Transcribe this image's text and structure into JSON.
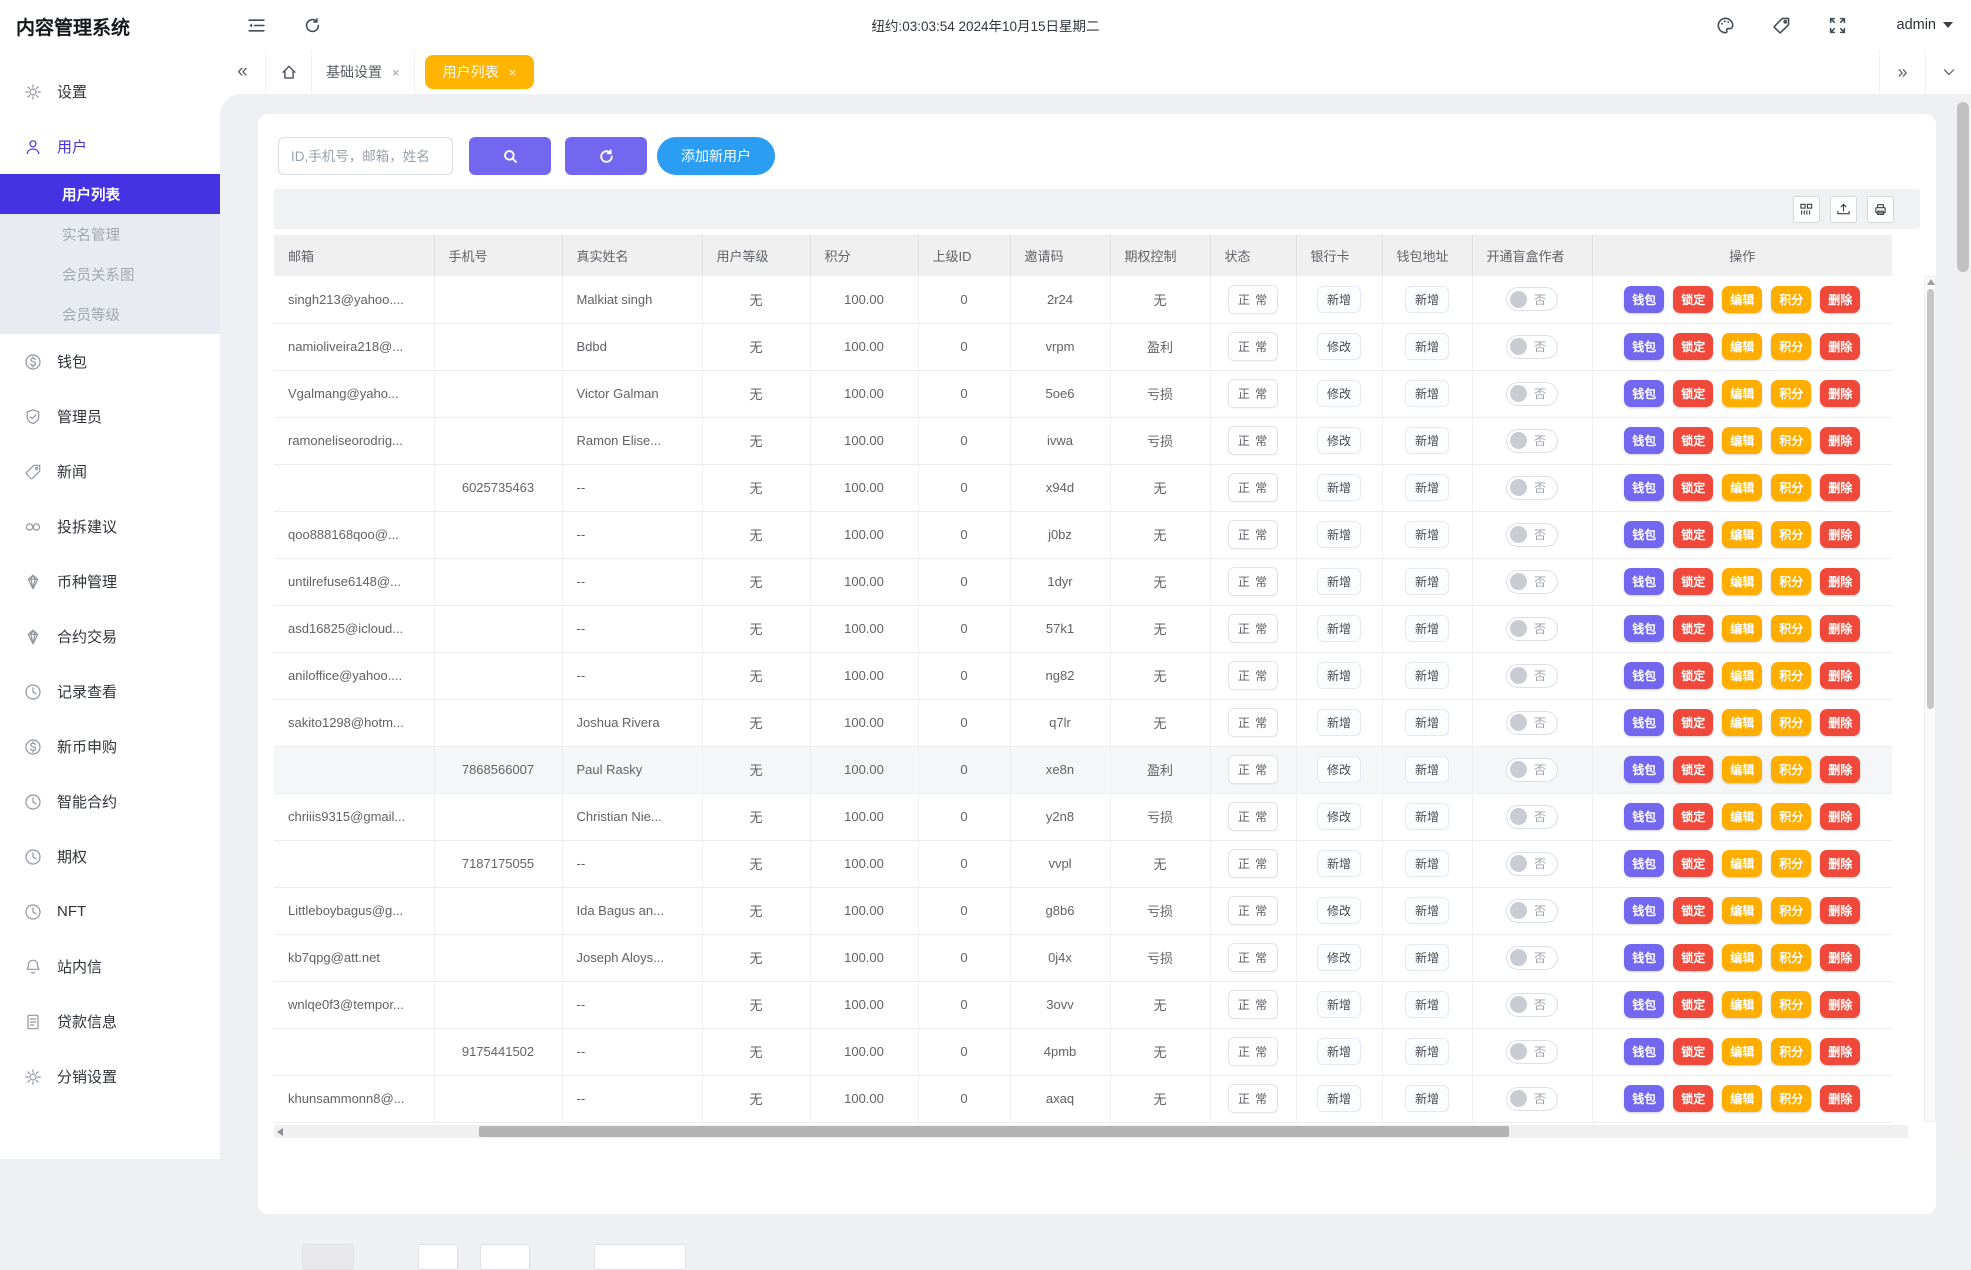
{
  "app": {
    "title": "内容管理系统",
    "clock": "纽约:03:03:54 2024年10月15日星期二",
    "user_menu": "admin"
  },
  "sidebar": {
    "items": [
      {
        "key": "settings",
        "icon": "gear",
        "label": "设置"
      },
      {
        "key": "users",
        "icon": "user",
        "label": "用户",
        "active": true,
        "children": [
          {
            "key": "user-list",
            "label": "用户列表",
            "active": true
          },
          {
            "key": "real-name",
            "label": "实名管理"
          },
          {
            "key": "member-graph",
            "label": "会员关系图"
          },
          {
            "key": "member-level",
            "label": "会员等级"
          }
        ]
      },
      {
        "key": "wallet",
        "icon": "dollar",
        "label": "钱包"
      },
      {
        "key": "admin",
        "icon": "shield",
        "label": "管理员"
      },
      {
        "key": "news",
        "icon": "tag",
        "label": "新闻"
      },
      {
        "key": "feedback",
        "icon": "link",
        "label": "投拆建议"
      },
      {
        "key": "currency-mgmt",
        "icon": "gem",
        "label": "币种管理"
      },
      {
        "key": "contract-trade",
        "icon": "gem",
        "label": "合约交易"
      },
      {
        "key": "record-view",
        "icon": "clock",
        "label": "记录查看"
      },
      {
        "key": "new-coin",
        "icon": "dollar",
        "label": "新币申购"
      },
      {
        "key": "smart-contract",
        "icon": "clock",
        "label": "智能合约"
      },
      {
        "key": "options",
        "icon": "clock",
        "label": "期权"
      },
      {
        "key": "nft",
        "icon": "clock",
        "label": "NFT"
      },
      {
        "key": "site-message",
        "icon": "bell",
        "label": "站内信"
      },
      {
        "key": "loan-info",
        "icon": "doc",
        "label": "贷款信息"
      },
      {
        "key": "distribution",
        "icon": "gear",
        "label": "分销设置"
      }
    ]
  },
  "tabs": {
    "items": [
      {
        "key": "basic-settings",
        "label": "基础设置",
        "active": false
      },
      {
        "key": "user-list",
        "label": "用户列表",
        "active": true
      }
    ]
  },
  "search": {
    "placeholder": "ID,手机号，邮箱，姓名",
    "add_button": "添加新用户"
  },
  "table": {
    "headers": [
      "邮箱",
      "手机号",
      "真实姓名",
      "用户等级",
      "积分",
      "上级ID",
      "邀请码",
      "期权控制",
      "状态",
      "银行卡",
      "钱包地址",
      "开通盲盒作者",
      "操作"
    ],
    "action_labels": [
      "钱包",
      "锁定",
      "编辑",
      "积分",
      "删除"
    ],
    "toggle_off_label": "否",
    "rows": [
      {
        "email": "singh213@yahoo....",
        "phone": "",
        "name": "Malkiat singh",
        "level": "无",
        "points": "100.00",
        "parent": "0",
        "invite": "2r24",
        "option": "无",
        "status": "正 常",
        "bank": "新增",
        "wallet": "新增",
        "blindbox": "否",
        "hover": false
      },
      {
        "email": "namioliveira218@...",
        "phone": "",
        "name": "Bdbd",
        "level": "无",
        "points": "100.00",
        "parent": "0",
        "invite": "vrpm",
        "option": "盈利",
        "status": "正 常",
        "bank": "修改",
        "wallet": "新增",
        "blindbox": "否",
        "hover": false
      },
      {
        "email": "Vgalmang@yaho...",
        "phone": "",
        "name": "Victor Galman",
        "level": "无",
        "points": "100.00",
        "parent": "0",
        "invite": "5oe6",
        "option": "亏损",
        "status": "正 常",
        "bank": "修改",
        "wallet": "新增",
        "blindbox": "否",
        "hover": false
      },
      {
        "email": "ramoneliseorodrig...",
        "phone": "",
        "name": "Ramon Elise...",
        "level": "无",
        "points": "100.00",
        "parent": "0",
        "invite": "ivwa",
        "option": "亏损",
        "status": "正 常",
        "bank": "修改",
        "wallet": "新增",
        "blindbox": "否",
        "hover": false
      },
      {
        "email": "",
        "phone": "6025735463",
        "name": "--",
        "level": "无",
        "points": "100.00",
        "parent": "0",
        "invite": "x94d",
        "option": "无",
        "status": "正 常",
        "bank": "新增",
        "wallet": "新增",
        "blindbox": "否",
        "hover": false
      },
      {
        "email": "qoo888168qoo@...",
        "phone": "",
        "name": "--",
        "level": "无",
        "points": "100.00",
        "parent": "0",
        "invite": "j0bz",
        "option": "无",
        "status": "正 常",
        "bank": "新增",
        "wallet": "新增",
        "blindbox": "否",
        "hover": false
      },
      {
        "email": "untilrefuse6148@...",
        "phone": "",
        "name": "--",
        "level": "无",
        "points": "100.00",
        "parent": "0",
        "invite": "1dyr",
        "option": "无",
        "status": "正 常",
        "bank": "新增",
        "wallet": "新增",
        "blindbox": "否",
        "hover": false
      },
      {
        "email": "asd16825@icloud...",
        "phone": "",
        "name": "--",
        "level": "无",
        "points": "100.00",
        "parent": "0",
        "invite": "57k1",
        "option": "无",
        "status": "正 常",
        "bank": "新增",
        "wallet": "新增",
        "blindbox": "否",
        "hover": false
      },
      {
        "email": "aniloffice@yahoo....",
        "phone": "",
        "name": "--",
        "level": "无",
        "points": "100.00",
        "parent": "0",
        "invite": "ng82",
        "option": "无",
        "status": "正 常",
        "bank": "新增",
        "wallet": "新增",
        "blindbox": "否",
        "hover": false
      },
      {
        "email": "sakito1298@hotm...",
        "phone": "",
        "name": "Joshua Rivera",
        "level": "无",
        "points": "100.00",
        "parent": "0",
        "invite": "q7lr",
        "option": "无",
        "status": "正 常",
        "bank": "新增",
        "wallet": "新增",
        "blindbox": "否",
        "hover": false
      },
      {
        "email": "",
        "phone": "7868566007",
        "name": "Paul Rasky",
        "level": "无",
        "points": "100.00",
        "parent": "0",
        "invite": "xe8n",
        "option": "盈利",
        "status": "正 常",
        "bank": "修改",
        "wallet": "新增",
        "blindbox": "否",
        "hover": true
      },
      {
        "email": "chriiis9315@gmail...",
        "phone": "",
        "name": "Christian Nie...",
        "level": "无",
        "points": "100.00",
        "parent": "0",
        "invite": "y2n8",
        "option": "亏损",
        "status": "正 常",
        "bank": "修改",
        "wallet": "新增",
        "blindbox": "否",
        "hover": false
      },
      {
        "email": "",
        "phone": "7187175055",
        "name": "--",
        "level": "无",
        "points": "100.00",
        "parent": "0",
        "invite": "vvpl",
        "option": "无",
        "status": "正 常",
        "bank": "新增",
        "wallet": "新增",
        "blindbox": "否",
        "hover": false
      },
      {
        "email": "Littleboybagus@g...",
        "phone": "",
        "name": "Ida Bagus an...",
        "level": "无",
        "points": "100.00",
        "parent": "0",
        "invite": "g8b6",
        "option": "亏损",
        "status": "正 常",
        "bank": "修改",
        "wallet": "新增",
        "blindbox": "否",
        "hover": false
      },
      {
        "email": "kb7qpg@att.net",
        "phone": "",
        "name": "Joseph Aloys...",
        "level": "无",
        "points": "100.00",
        "parent": "0",
        "invite": "0j4x",
        "option": "亏损",
        "status": "正 常",
        "bank": "修改",
        "wallet": "新增",
        "blindbox": "否",
        "hover": false
      },
      {
        "email": "wnlqe0f3@tempor...",
        "phone": "",
        "name": "--",
        "level": "无",
        "points": "100.00",
        "parent": "0",
        "invite": "3ovv",
        "option": "无",
        "status": "正 常",
        "bank": "新增",
        "wallet": "新增",
        "blindbox": "否",
        "hover": false
      },
      {
        "email": "",
        "phone": "9175441502",
        "name": "--",
        "level": "无",
        "points": "100.00",
        "parent": "0",
        "invite": "4pmb",
        "option": "无",
        "status": "正 常",
        "bank": "新增",
        "wallet": "新增",
        "blindbox": "否",
        "hover": false
      },
      {
        "email": "khunsammonn8@...",
        "phone": "",
        "name": "--",
        "level": "无",
        "points": "100.00",
        "parent": "0",
        "invite": "axaq",
        "option": "无",
        "status": "正 常",
        "bank": "新增",
        "wallet": "新增",
        "blindbox": "否",
        "hover": false
      }
    ]
  },
  "colors": {
    "accent_purple": "#4432e3",
    "button_purple": "#7367f0",
    "button_blue": "#2b9ef3",
    "tab_orange": "#ffb400",
    "action_red": "#f0493c",
    "action_amber": "#ffae00"
  }
}
